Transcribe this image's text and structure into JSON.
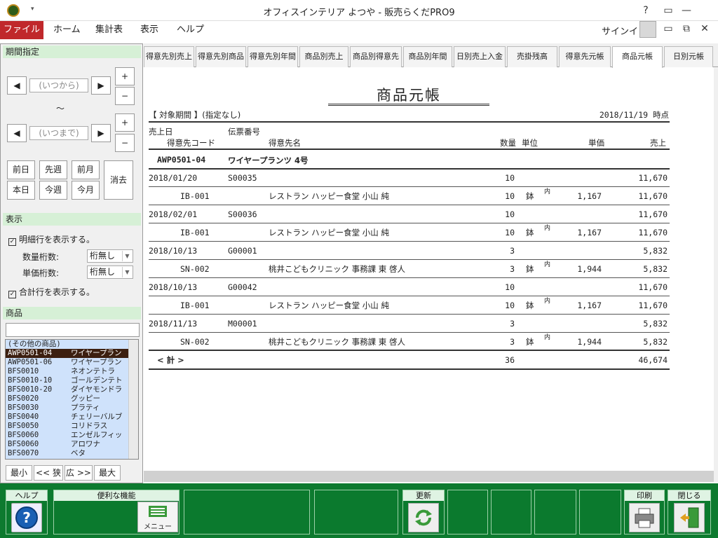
{
  "window": {
    "title": "オフィスインテリア よつや - 販売らくだPRO9",
    "help_label": "?",
    "qa_arrow": "▾"
  },
  "menu": {
    "items": [
      "ファイル",
      "ホーム",
      "集計表",
      "表示",
      "ヘルプ"
    ],
    "signin": "サインイン"
  },
  "left": {
    "period_title": "期間指定",
    "from_placeholder": "(いつから)",
    "to_placeholder": "(いつまで)",
    "tilde": "〜",
    "quick": [
      "前日",
      "先週",
      "前月",
      "本日",
      "今週",
      "今月"
    ],
    "clear": "消去",
    "display_title": "表示",
    "show_detail": "明細行を表示する。",
    "qty_digits_label": "数量桁数:",
    "qty_digits_value": "桁無し",
    "price_digits_label": "単価桁数:",
    "price_digits_value": "桁無し",
    "show_total": "合計行を表示する。",
    "product_title": "商品",
    "product_list": [
      {
        "code": "(その他の商品)",
        "name": ""
      },
      {
        "code": "AWP0501-04",
        "name": "ワイヤープラン"
      },
      {
        "code": "AWP0501-06",
        "name": "ワイヤープラン"
      },
      {
        "code": "BFS0010",
        "name": "ネオンテトラ"
      },
      {
        "code": "BFS0010-10",
        "name": "ゴールデンテト"
      },
      {
        "code": "BFS0010-20",
        "name": "ダイヤモンドラ"
      },
      {
        "code": "BFS0020",
        "name": "グッピー"
      },
      {
        "code": "BFS0030",
        "name": "プラティ"
      },
      {
        "code": "BFS0040",
        "name": "チェリーバルブ"
      },
      {
        "code": "BFS0050",
        "name": "コリドラス"
      },
      {
        "code": "BFS0060",
        "name": "エンゼルフィッ"
      },
      {
        "code": "BFS0060",
        "name": "アロワナ"
      },
      {
        "code": "BFS0070",
        "name": "ベタ"
      }
    ],
    "zoom": [
      "最小",
      "<< 狭",
      "広 >>",
      "最大"
    ]
  },
  "tabs": [
    "得意先別売上",
    "得意先別商品",
    "得意先別年間",
    "商品別売上",
    "商品別得意先",
    "商品別年間",
    "日別売上入金",
    "売掛残高",
    "得意先元帳",
    "商品元帳",
    "日別元帳"
  ],
  "active_tab": "商品元帳",
  "report": {
    "title": "商品元帳",
    "period_label": "【 対象期間 】(指定なし)",
    "as_of": "2018/11/19 時点",
    "h_date": "売上日",
    "h_slip": "伝票番号",
    "h_code": "得意先コード",
    "h_cust": "得意先名",
    "h_qty": "数量",
    "h_unit": "単位",
    "h_price": "単価",
    "h_sales": "売上",
    "product_code": "AWP0501-04",
    "product_name": "ワイヤープランツ 4号",
    "rows": [
      {
        "date": "2018/01/20",
        "slip": "S00035",
        "qty": "10",
        "sales": "11,670",
        "dcode": "IB-001",
        "cust": "レストラン ハッピー食堂 小山 純",
        "dqty": "10",
        "unit": "鉢",
        "tax": "内",
        "price": "1,167",
        "dsales": "11,670"
      },
      {
        "date": "2018/02/01",
        "slip": "S00036",
        "qty": "10",
        "sales": "11,670",
        "dcode": "IB-001",
        "cust": "レストラン ハッピー食堂 小山 純",
        "dqty": "10",
        "unit": "鉢",
        "tax": "内",
        "price": "1,167",
        "dsales": "11,670"
      },
      {
        "date": "2018/10/13",
        "slip": "G00001",
        "qty": "3",
        "sales": "5,832",
        "dcode": "SN-002",
        "cust": "桃井こどもクリニック 事務課 東 啓人",
        "dqty": "3",
        "unit": "鉢",
        "tax": "内",
        "price": "1,944",
        "dsales": "5,832"
      },
      {
        "date": "2018/10/13",
        "slip": "G00042",
        "qty": "10",
        "sales": "11,670",
        "dcode": "IB-001",
        "cust": "レストラン ハッピー食堂 小山 純",
        "dqty": "10",
        "unit": "鉢",
        "tax": "内",
        "price": "1,167",
        "dsales": "11,670"
      },
      {
        "date": "2018/11/13",
        "slip": "M00001",
        "qty": "3",
        "sales": "5,832",
        "dcode": "SN-002",
        "cust": "桃井こどもクリニック 事務課 東 啓人",
        "dqty": "3",
        "unit": "鉢",
        "tax": "内",
        "price": "1,944",
        "dsales": "5,832"
      }
    ],
    "total_label": "< 計 >",
    "total_qty": "36",
    "total_sales": "46,674"
  },
  "bottom": {
    "help": "ヘルプ",
    "functions": "便利な機能",
    "menu": "メニュー",
    "refresh": "更新",
    "print": "印刷",
    "close": "閉じる"
  },
  "colors": {
    "accent_red": "#c0282b",
    "bottom_green": "#0d7a2f",
    "section_green": "#d6f0d6"
  }
}
